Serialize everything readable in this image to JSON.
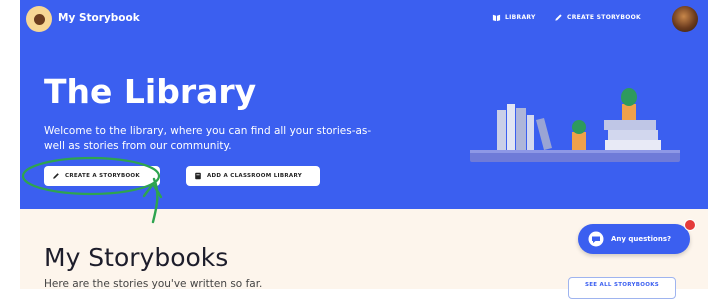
{
  "nav": {
    "brand": "My Storybook",
    "library_label": "LIBRARY",
    "create_label": "CREATE STORYBOOK"
  },
  "hero": {
    "title": "The Library",
    "subtitle": "Welcome to the library, where you can find all your stories-as-well as stories from our community.",
    "create_button": "CREATE A STORYBOOK",
    "classroom_button": "ADD A CLASSROOM LIBRARY"
  },
  "section": {
    "title": "My Storybooks",
    "subtitle": "Here are the stories you've written so far.",
    "see_all": "SEE ALL STORYBOOKS"
  },
  "chat": {
    "label": "Any questions?"
  },
  "colors": {
    "hero_bg": "#3b5ff0",
    "page_bg": "#fdf5ec",
    "annotation": "#2ea44f",
    "badge": "#e53b3b"
  },
  "icons": {
    "logo": "storybook-logo-icon",
    "library": "book-icon",
    "create": "pencil-icon",
    "classroom": "classroom-book-icon",
    "chat": "chat-bubble-icon"
  }
}
